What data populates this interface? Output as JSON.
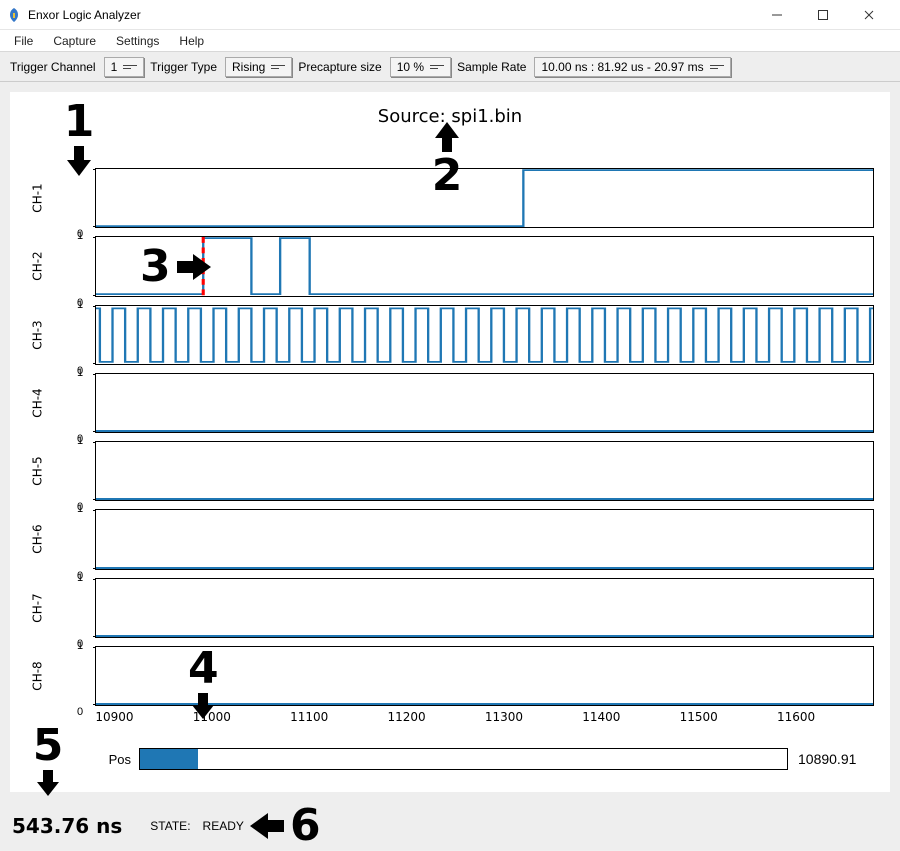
{
  "window": {
    "title": "Enxor Logic Analyzer",
    "controls": {
      "minimize": "–",
      "maximize": "□",
      "close": "×"
    }
  },
  "menu": {
    "items": [
      "File",
      "Capture",
      "Settings",
      "Help"
    ]
  },
  "toolbar": {
    "trigger_channel": {
      "label": "Trigger Channel",
      "value": "1"
    },
    "trigger_type": {
      "label": "Trigger Type",
      "value": "Rising"
    },
    "precapture": {
      "label": "Precapture size",
      "value": "10 %"
    },
    "sample_rate": {
      "label": "Sample Rate",
      "value": "10.00 ns : 81.92 us - 20.97 ms"
    }
  },
  "source_title": "Source: spi1.bin",
  "channels": [
    "CH-1",
    "CH-2",
    "CH-3",
    "CH-4",
    "CH-5",
    "CH-6",
    "CH-7",
    "CH-8"
  ],
  "xaxis": {
    "ticks": [
      "10900",
      "11000",
      "11100",
      "11200",
      "11300",
      "11400",
      "11500",
      "11600"
    ]
  },
  "position": {
    "label": "Pos",
    "value": "10890.91",
    "thumb_percent": 9
  },
  "status": {
    "cursor_time": "543.76 ns",
    "state_label": "STATE:",
    "state_value": "READY"
  },
  "annotations": {
    "1": "1",
    "2": "2",
    "3": "3",
    "4": "4",
    "5": "5",
    "6": "6"
  },
  "chart_data": {
    "type": "logic-analyzer",
    "x_range": [
      10880,
      11680
    ],
    "channels": [
      {
        "name": "CH-1",
        "edges": [
          [
            10880,
            0
          ],
          [
            11320,
            1
          ],
          [
            11680,
            1
          ]
        ],
        "trigger_marker_at": null
      },
      {
        "name": "CH-2",
        "edges": [
          [
            10880,
            0
          ],
          [
            10990,
            1
          ],
          [
            11040,
            0
          ],
          [
            11070,
            1
          ],
          [
            11100,
            0
          ],
          [
            11680,
            0
          ]
        ],
        "trigger_marker_at": 10990
      },
      {
        "name": "CH-3",
        "kind": "clock",
        "period": 26,
        "first_edge": 10884,
        "duty": 0.5
      },
      {
        "name": "CH-4",
        "edges": [
          [
            10880,
            0
          ],
          [
            11680,
            0
          ]
        ]
      },
      {
        "name": "CH-5",
        "edges": [
          [
            10880,
            0
          ],
          [
            11680,
            0
          ]
        ]
      },
      {
        "name": "CH-6",
        "edges": [
          [
            10880,
            0
          ],
          [
            11680,
            0
          ]
        ]
      },
      {
        "name": "CH-7",
        "edges": [
          [
            10880,
            0
          ],
          [
            11680,
            0
          ]
        ]
      },
      {
        "name": "CH-8",
        "edges": [
          [
            10880,
            0
          ],
          [
            11680,
            0
          ]
        ]
      }
    ],
    "x_ticks": [
      10900,
      11000,
      11100,
      11200,
      11300,
      11400,
      11500,
      11600
    ]
  }
}
